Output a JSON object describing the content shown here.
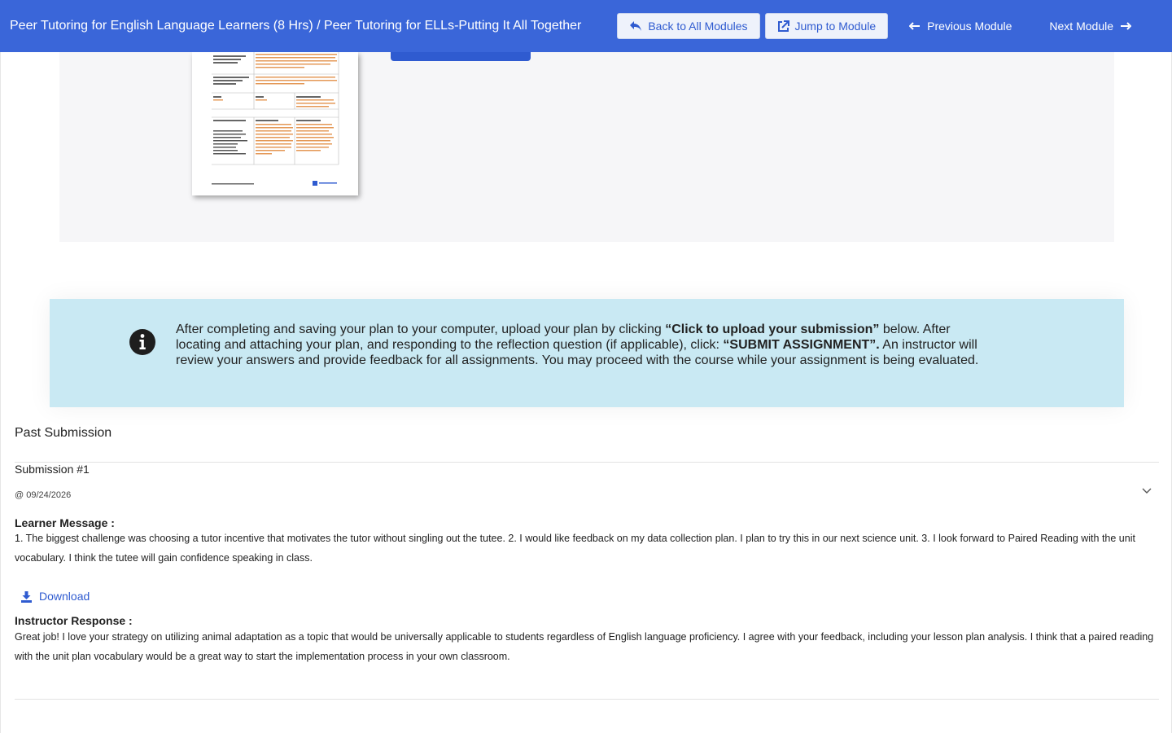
{
  "header": {
    "breadcrumb": "Peer Tutoring for English Language Learners (8 Hrs) / Peer Tutoring for ELLs-Putting It All Together",
    "back_label": "Back to All Modules",
    "back_icon": "reply-arrow-icon",
    "jump_label": "Jump to Module",
    "jump_icon": "external-link-icon",
    "prev_label": "Previous Module",
    "prev_icon": "arrow-left-icon",
    "next_label": "Next Module",
    "next_icon": "arrow-right-icon"
  },
  "info": {
    "icon": "info-circle-icon",
    "t1": "After completing and saving your plan to your computer, upload your plan by clicking ",
    "b1": "“Click to upload your submission”",
    "t2": " below.  After locating and attaching your plan, and responding to the reflection question (if applicable), click: ",
    "b2": "“SUBMIT ASSIGNMENT”.",
    "t3": "   An instructor will review your answers and provide feedback for all assignments.  You may proceed with the course while your assignment is being evaluated."
  },
  "submission": {
    "section_title": "Past Submission",
    "title": "Submission #1",
    "date": "@ 09/24/2026",
    "learner_label": "Learner Message :",
    "learner_message": "1. The biggest challenge was choosing a tutor incentive that motivates the tutor without singling out the tutee. 2. I would like feedback on my data collection plan. I plan to try this in our next science unit. 3. I look forward to Paired Reading with the unit vocabulary. I think the tutee will gain confidence speaking in class.",
    "download_label": "Download",
    "download_icon": "download-icon",
    "instructor_label": "Instructor Response :",
    "instructor_response": "Great job! I love your strategy on utilizing animal adaptation as a topic that would be universally applicable to students regardless of English language proficiency. I agree with your feedback, including your lesson plan analysis. I think that a paired reading with the unit plan vocabulary would be a great way to start the implementation process in your own classroom."
  },
  "colors": {
    "primary": "#3a66d9",
    "info_bg": "#c9e9f3",
    "link": "#2f5bd0"
  }
}
